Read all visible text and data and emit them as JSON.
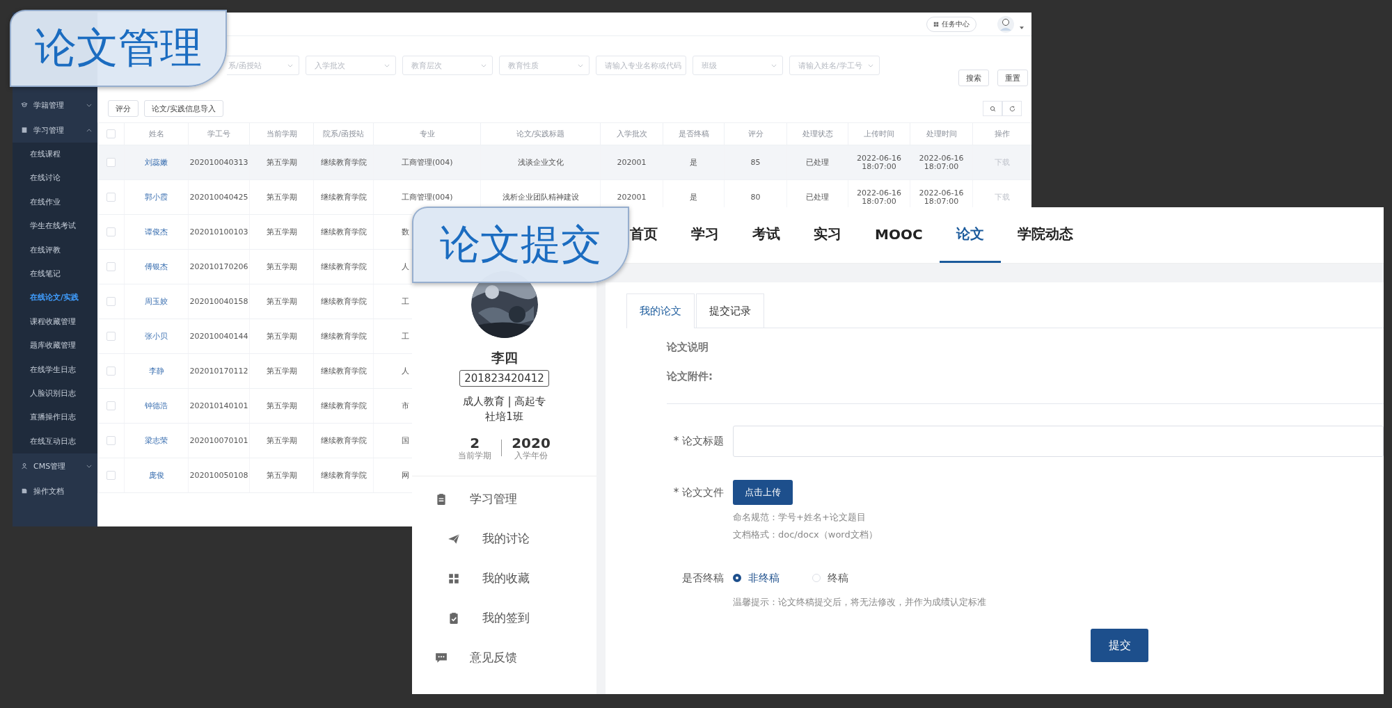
{
  "admin_badge": {
    "title": "论文管理"
  },
  "submit_badge": {
    "title": "论文提交"
  },
  "admin": {
    "header": {
      "task_center": "任务中心"
    },
    "sidebar": {
      "items": [
        {
          "label": "学籍管理",
          "kind": "group",
          "expanded": false
        },
        {
          "label": "学习管理",
          "kind": "group",
          "expanded": true,
          "children": [
            {
              "label": "在线课程",
              "selected": false
            },
            {
              "label": "在线讨论",
              "selected": false
            },
            {
              "label": "在线作业",
              "selected": false
            },
            {
              "label": "学生在线考试",
              "selected": false
            },
            {
              "label": "在线评教",
              "selected": false
            },
            {
              "label": "在线笔记",
              "selected": false
            },
            {
              "label": "在线论文/实践",
              "selected": true
            },
            {
              "label": "课程收藏管理",
              "selected": false
            },
            {
              "label": "题库收藏管理",
              "selected": false
            },
            {
              "label": "在线学生日志",
              "selected": false
            },
            {
              "label": "人脸识别日志",
              "selected": false
            },
            {
              "label": "直播操作日志",
              "selected": false
            },
            {
              "label": "在线互动日志",
              "selected": false
            }
          ]
        },
        {
          "label": "CMS管理",
          "kind": "group",
          "expanded": false
        },
        {
          "label": "操作文档",
          "kind": "link"
        }
      ]
    },
    "filters": [
      {
        "placeholder": "系/函授站"
      },
      {
        "placeholder": "入学批次"
      },
      {
        "placeholder": "教育层次"
      },
      {
        "placeholder": "教育性质"
      },
      {
        "placeholder": "请输入专业名称或代码"
      },
      {
        "placeholder": "班级"
      },
      {
        "placeholder": "请输入姓名/学工号"
      }
    ],
    "actions": [
      "搜索",
      "重置"
    ],
    "toolbar": [
      "评分",
      "论文/实践信息导入"
    ],
    "table": {
      "all_checked": false,
      "columns": [
        "姓名",
        "学工号",
        "当前学期",
        "院系/函授站",
        "专业",
        "论文/实践标题",
        "入学批次",
        "是否终稿",
        "评分",
        "处理状态",
        "上传时间",
        "处理时间",
        "操作"
      ],
      "rows": [
        {
          "selected": true,
          "checked": false,
          "name": "刘蕊嫩",
          "id": "202010040313",
          "term": "第五学期",
          "dept": "继续教育学院",
          "major": "工商管理(004)",
          "title": "浅谈企业文化",
          "batch": "202001",
          "final": "是",
          "score": "85",
          "status": "已处理",
          "uploaded": [
            "2022-06-16",
            "18:07:00"
          ],
          "processed": [
            "2022-06-16",
            "18:07:00"
          ],
          "action": "下载"
        },
        {
          "selected": false,
          "checked": false,
          "name": "郭小霞",
          "id": "202010040425",
          "term": "第五学期",
          "dept": "继续教育学院",
          "major": "工商管理(004)",
          "title": "浅析企业团队精神建设",
          "batch": "202001",
          "final": "是",
          "score": "80",
          "status": "已处理",
          "uploaded": [
            "2022-06-16",
            "18:07:00"
          ],
          "processed": [
            "2022-06-16",
            "18:07:00"
          ],
          "action": "下载"
        },
        {
          "selected": false,
          "checked": false,
          "name": "谭俊杰",
          "id": "202010100103",
          "term": "第五学期",
          "dept": "继续教育学院",
          "major": "数"
        },
        {
          "selected": false,
          "checked": false,
          "name": "傅银杰",
          "id": "202010170206",
          "term": "第五学期",
          "dept": "继续教育学院",
          "major": "人"
        },
        {
          "selected": false,
          "checked": false,
          "name": "周玉姣",
          "id": "202010040158",
          "term": "第五学期",
          "dept": "继续教育学院",
          "major": "工"
        },
        {
          "selected": false,
          "checked": false,
          "name": "张小贝",
          "id": "202010040144",
          "term": "第五学期",
          "dept": "继续教育学院",
          "major": "工"
        },
        {
          "selected": false,
          "checked": false,
          "name": "李静",
          "id": "202010170112",
          "term": "第五学期",
          "dept": "继续教育学院",
          "major": "人"
        },
        {
          "selected": false,
          "checked": false,
          "name": "钟德浩",
          "id": "202010140101",
          "term": "第五学期",
          "dept": "继续教育学院",
          "major": "市"
        },
        {
          "selected": false,
          "checked": false,
          "name": "梁志荣",
          "id": "202010070101",
          "term": "第五学期",
          "dept": "继续教育学院",
          "major": "国"
        },
        {
          "selected": false,
          "checked": false,
          "name": "庞俊",
          "id": "202010050108",
          "term": "第五学期",
          "dept": "继续教育学院",
          "major": "网"
        }
      ]
    }
  },
  "portal": {
    "nav": [
      {
        "label": "首页",
        "selected": false
      },
      {
        "label": "学习",
        "selected": false
      },
      {
        "label": "考试",
        "selected": false
      },
      {
        "label": "实习",
        "selected": false
      },
      {
        "label": "MOOC",
        "selected": false
      },
      {
        "label": "论文",
        "selected": true
      },
      {
        "label": "学院动态",
        "selected": false
      }
    ],
    "profile": {
      "name": "李四",
      "student_id": "201823420412",
      "program": "成人教育 | 高起专",
      "class": "社培1班",
      "stats": [
        {
          "value": "2",
          "label": "当前学期"
        },
        {
          "value": "2020",
          "label": "入学年份"
        }
      ]
    },
    "menu": [
      {
        "label": "学习管理",
        "kind": "top"
      },
      {
        "label": "我的讨论",
        "kind": "sub"
      },
      {
        "label": "我的收藏",
        "kind": "sub"
      },
      {
        "label": "我的签到",
        "kind": "sub"
      },
      {
        "label": "意见反馈",
        "kind": "top"
      }
    ],
    "tabs": [
      {
        "label": "我的论文",
        "selected": true
      },
      {
        "label": "提交记录",
        "selected": false
      }
    ],
    "info": [
      "论文说明",
      "论文附件:"
    ],
    "form": {
      "title_label": "* 论文标题",
      "file_label": "* 论文文件",
      "upload_button": "点击上传",
      "hints": [
        "命名规范：学号+姓名+论文题目",
        "文档格式：doc/docx（word文档）"
      ],
      "final_label": "是否终稿",
      "options": [
        {
          "label": "非终稿",
          "selected": true
        },
        {
          "label": "终稿",
          "selected": false
        }
      ],
      "tip": "温馨提示：论文终稿提交后，将无法修改，并作为成绩认定标准",
      "submit": "提交"
    }
  }
}
